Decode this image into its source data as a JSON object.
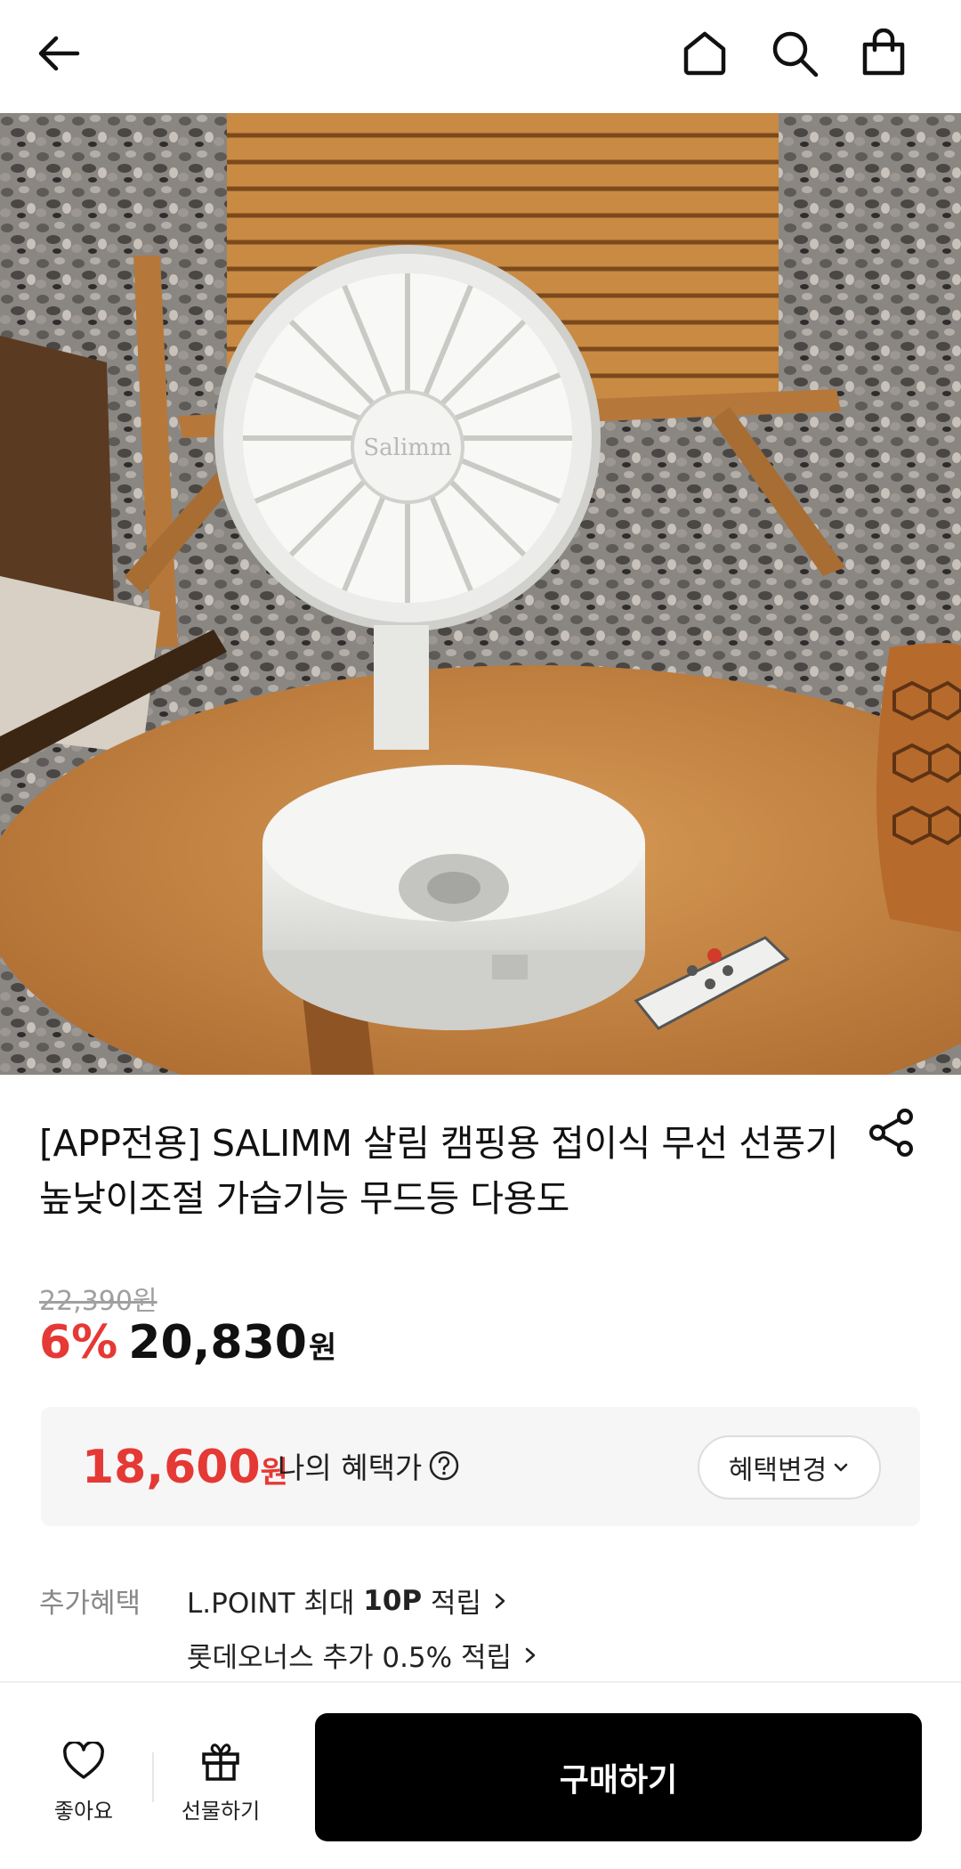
{
  "product": {
    "title": "[APP전용] SALIMM 살림 캠핑용 접이식 무선 선풍기 높낮이조절 가습기능 무드등 다용도",
    "original_price": "22,390원",
    "discount": "6%",
    "price": "20,830",
    "price_unit": "원",
    "fan_brand": "Salimm"
  },
  "benefit": {
    "price": "18,600",
    "price_unit": "원",
    "label": "나의 혜택가",
    "change_button": "혜택변경"
  },
  "extra": {
    "label": "추가혜택",
    "line1_prefix": "L.POINT 최대 ",
    "line1_bold": "10P",
    "line1_suffix": " 적립",
    "line2": "롯데오너스 추가 0.5% 적립"
  },
  "bottom": {
    "like_label": "좋아요",
    "gift_label": "선물하기",
    "buy_label": "구매하기"
  },
  "icons": {
    "back": "arrow-left",
    "home": "home",
    "search": "search",
    "cart": "shopping-bag",
    "share": "share",
    "help": "question-circle",
    "like": "heart",
    "gift": "gift"
  },
  "colors": {
    "discount": "#e53935",
    "buy_button": "#000000",
    "benefit_box": "#f6f6f6"
  }
}
